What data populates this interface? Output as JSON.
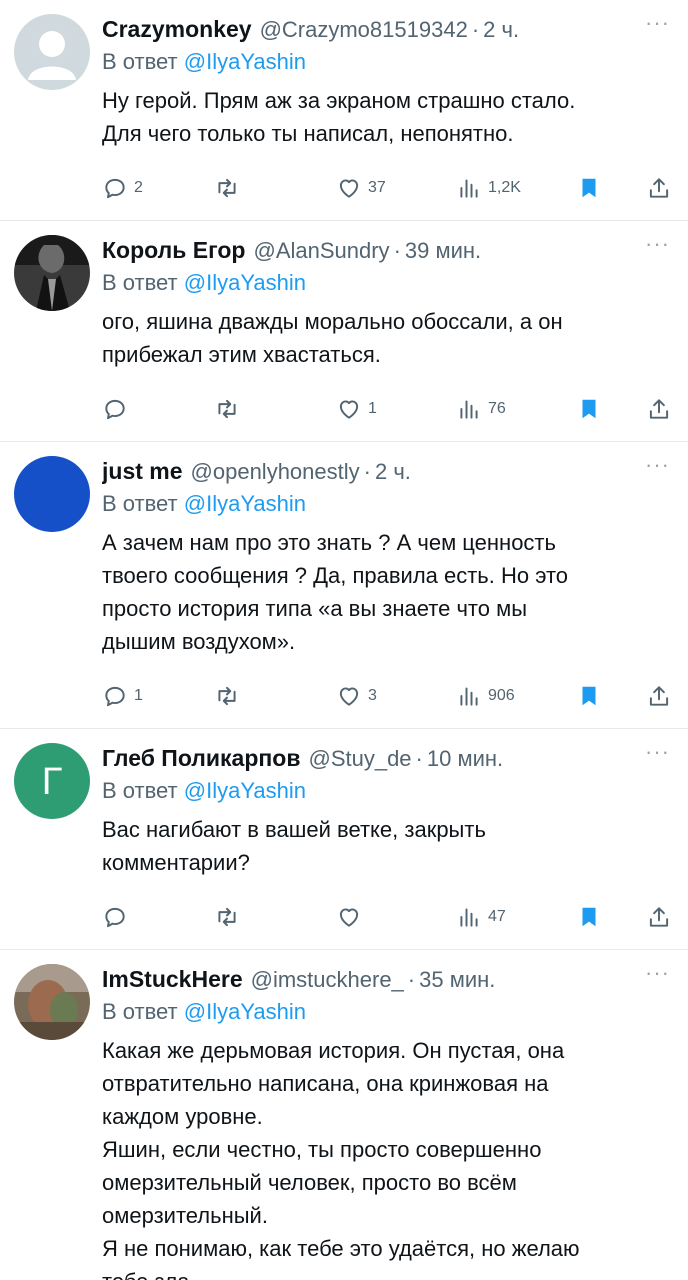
{
  "reply_prefix": "В ответ",
  "tweets": [
    {
      "name": "Crazymonkey",
      "handle": "@Crazymo81519342",
      "time": "2 ч.",
      "reply_to": "@IlyaYashin",
      "text": [
        "Ну герой. Прям аж за экраном страшно стало.",
        "Для чего только ты написал, непонятно."
      ],
      "replies": "2",
      "retweets": "",
      "likes": "37",
      "views": "1,2K",
      "avatar": {
        "type": "default",
        "color": "#cfd9de"
      }
    },
    {
      "name": "Король Егор",
      "handle": "@AlanSundry",
      "time": "39 мин.",
      "reply_to": "@IlyaYashin",
      "text": [
        "ого, яшина дважды морально обоссали, а он",
        "прибежал этим хвастаться."
      ],
      "replies": "",
      "retweets": "",
      "likes": "1",
      "views": "76",
      "avatar": {
        "type": "photo-dark",
        "color": "#2b2b2b"
      }
    },
    {
      "name": "just me",
      "handle": "@openlyhonestly",
      "time": "2 ч.",
      "reply_to": "@IlyaYashin",
      "text": [
        "А зачем нам про это знать ? А чем ценность",
        "твоего сообщения ? Да, правила есть. Но это",
        "просто история типа «а вы знаете что мы",
        "дышим воздухом»."
      ],
      "replies": "1",
      "retweets": "",
      "likes": "3",
      "views": "906",
      "avatar": {
        "type": "solid",
        "color": "#1550c8"
      }
    },
    {
      "name": "Глеб Поликарпов",
      "handle": "@Stuy_de",
      "time": "10 мин.",
      "reply_to": "@IlyaYashin",
      "text": [
        "Вас нагибают в вашей ветке, закрыть",
        "комментарии?"
      ],
      "replies": "",
      "retweets": "",
      "likes": "",
      "views": "47",
      "avatar": {
        "type": "letter",
        "letter": "Г",
        "color": "#2e9d73"
      }
    },
    {
      "name": "ImStuckHere",
      "handle": "@imstuckhere_",
      "time": "35 мин.",
      "reply_to": "@IlyaYashin",
      "text": [
        "Какая же дерьмовая история. Он пустая, она",
        "отвратительно написана, она кринжовая на",
        "каждом уровне.",
        "Яшин, если честно, ты просто совершенно",
        "омерзительный человек, просто во всём",
        "омерзительный.",
        "Я не понимаю, как тебе это удаётся, но желаю",
        "тебе зла"
      ],
      "replies": "",
      "retweets": "",
      "likes": "",
      "views": "",
      "avatar": {
        "type": "photo-warm",
        "color": "#8a7060"
      }
    }
  ],
  "colors": {
    "accent": "#1d9bf0",
    "muted": "#536471",
    "bookmark": "#1d9bf0"
  }
}
